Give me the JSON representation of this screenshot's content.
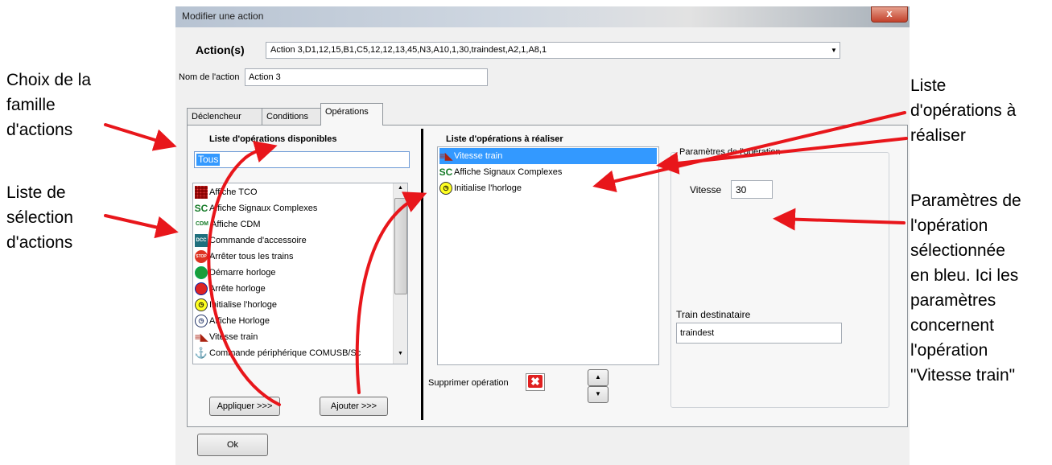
{
  "window": {
    "title": "Modifier une action",
    "close_label": "x"
  },
  "actions": {
    "label": "Action(s)",
    "selected": "Action 3,D1,12,15,B1,C5,12,12,13,45,N3,A10,1,30,traindest,A2,1,A8,1"
  },
  "action_name": {
    "label": "Nom de l'action",
    "value": "Action 3"
  },
  "tabs": [
    {
      "label": "Déclencheur"
    },
    {
      "label": "Conditions"
    },
    {
      "label": "Opérations"
    }
  ],
  "available": {
    "header": "Liste d'opérations disponibles",
    "family_value": "Tous",
    "items": [
      {
        "label": "Affiche TCO",
        "icon": "tco-grid-icon"
      },
      {
        "label": "Affiche Signaux Complexes",
        "icon": "sc-icon"
      },
      {
        "label": "Affiche CDM",
        "icon": "cdm-icon"
      },
      {
        "label": "Commande d'accessoire",
        "icon": "dcc-icon"
      },
      {
        "label": "Arrêter tous les trains",
        "icon": "stop-icon"
      },
      {
        "label": "Démarre horloge",
        "icon": "clock-start-icon"
      },
      {
        "label": "Arrête horloge",
        "icon": "clock-stop-icon"
      },
      {
        "label": "Initialise l'horloge",
        "icon": "clock-init-icon"
      },
      {
        "label": "Affiche Horloge",
        "icon": "clock-icon"
      },
      {
        "label": "Vitesse train",
        "icon": "train-speed-icon"
      },
      {
        "label": "Commande périphérique COMUSB/Sc",
        "icon": "anchor-icon"
      }
    ],
    "apply_button": "Appliquer >>>",
    "add_button": "Ajouter >>>"
  },
  "to_perform": {
    "header": "Liste d'opérations à réaliser",
    "items": [
      {
        "label": "Vitesse train",
        "icon": "train-speed-icon",
        "selected": true
      },
      {
        "label": "Affiche Signaux Complexes",
        "icon": "sc-icon",
        "selected": false
      },
      {
        "label": "Initialise l'horloge",
        "icon": "clock-init-icon",
        "selected": false
      }
    ],
    "delete_label": "Supprimer opération"
  },
  "params": {
    "group_title": "Paramètres de l'opération",
    "speed_label": "Vitesse",
    "speed_value": "30",
    "train_label": "Train destinataire",
    "train_value": "traindest"
  },
  "ok_button": "Ok",
  "annotations": {
    "family_choice": [
      "Choix de la",
      "famille",
      "d'actions"
    ],
    "selection_list": [
      "Liste de",
      "sélection",
      "d'actions"
    ],
    "ops_list": [
      "Liste",
      "d'opérations à",
      "réaliser"
    ],
    "params_note": [
      "Paramètres de",
      "l'opération",
      "sélectionnée",
      "en bleu. Ici les",
      "paramètres",
      "concernent",
      "l'opération",
      "\"Vitesse train\""
    ]
  },
  "colors": {
    "selection": "#3399ff",
    "arrow": "#e8161b",
    "delete_red": "#e02020"
  }
}
